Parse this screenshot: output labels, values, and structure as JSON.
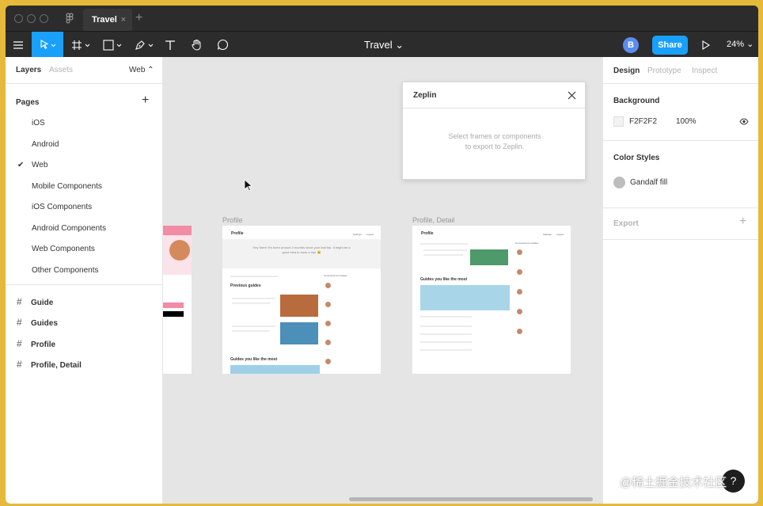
{
  "titlebar": {
    "tab_title": "Travel",
    "tab_close": "×",
    "new_tab": "+"
  },
  "toolbar": {
    "file_title": "Travel ⌄",
    "avatar": "B",
    "share_label": "Share",
    "zoom_label": "24% ⌄"
  },
  "left_panel": {
    "tabs": {
      "layers": "Layers",
      "assets": "Assets",
      "page_select": "Web ⌃"
    },
    "pages_title": "Pages",
    "add_page": "+",
    "pages": [
      {
        "label": "iOS",
        "checked": false
      },
      {
        "label": "Android",
        "checked": false
      },
      {
        "label": "Web",
        "checked": true
      },
      {
        "label": "Mobile Components",
        "checked": false
      },
      {
        "label": "iOS Components",
        "checked": false
      },
      {
        "label": "Android Components",
        "checked": false
      },
      {
        "label": "Web Components",
        "checked": false
      },
      {
        "label": "Other Components",
        "checked": false
      }
    ],
    "check_mark": "✔",
    "frames": [
      {
        "label": "Guide"
      },
      {
        "label": "Guides"
      },
      {
        "label": "Profile"
      },
      {
        "label": "Profile, Detail"
      }
    ],
    "frame_glyph": "#"
  },
  "canvas": {
    "zeplin": {
      "title": "Zeplin",
      "message_line1": "Select frames or components",
      "message_line2": "to export to Zeplin."
    },
    "frame_labels": {
      "profile": "Profile",
      "profile_detail": "Profile, Detail"
    },
    "profile_frame": {
      "header_title": "Profile",
      "nav_1": "Settings",
      "nav_2": "Logout",
      "hero_text_1": "Hey there! It's been around 3 months since your last trip. It might be a",
      "hero_text_2": "good idea to book a trip! 😊",
      "previous_guides": "Previous guides",
      "guides_like": "Guides you like the most",
      "comments_title": "Comments for Guides"
    },
    "detail_frame": {
      "header_title": "Profile",
      "nav_1": "Settings",
      "nav_2": "Logout",
      "guides_like": "Guides you like the most",
      "comments_title": "Comments for Guides"
    }
  },
  "right_panel": {
    "tabs": {
      "design": "Design",
      "prototype": "Prototype",
      "inspect": "Inspect"
    },
    "background_title": "Background",
    "background_hex": "F2F2F2",
    "background_opacity": "100%",
    "color_styles_title": "Color Styles",
    "color_style_name": "Gandalf fill",
    "export_title": "Export",
    "export_add": "+"
  },
  "help_label": "?",
  "watermark": "@稀土掘金技术社区",
  "colors": {
    "accent": "#18a0fb",
    "canvas": "#e5e5e5",
    "toolbar": "#2c2c2c",
    "background_swatch": "#F2F2F2",
    "gandalf": "#bdbdbd"
  }
}
